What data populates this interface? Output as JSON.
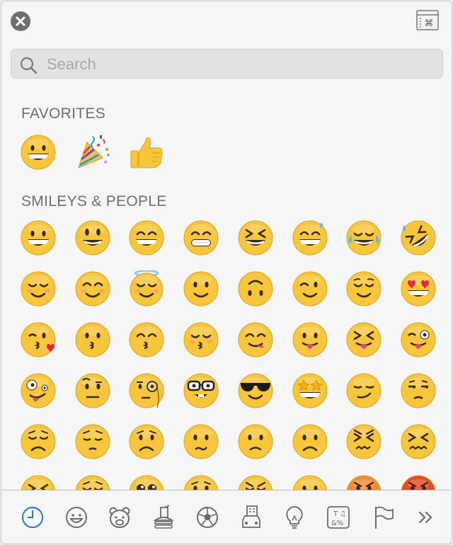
{
  "window": {
    "close_label": "Close",
    "keyboard_viewer_label": "Show Keyboard Viewer"
  },
  "search": {
    "placeholder": "Search",
    "value": ""
  },
  "sections": [
    {
      "title": "FAVORITES",
      "items": [
        "grinning",
        "party-popper",
        "thumbs-up"
      ]
    },
    {
      "title": "SMILEYS & PEOPLE",
      "items": [
        "grinning",
        "smiley",
        "smile",
        "grin",
        "laughing",
        "sweat-smile",
        "joy",
        "rofl",
        "relaxed",
        "blush",
        "innocent",
        "slight-smile",
        "upside-down",
        "wink",
        "relieved",
        "heart-eyes",
        "kissing-heart",
        "kissing",
        "kissing-smiling-eyes",
        "kissing-closed-eyes",
        "yum",
        "tongue",
        "squinting-tongue",
        "winking-tongue",
        "zany",
        "raised-eyebrow",
        "monocle",
        "nerd",
        "sunglasses",
        "star-struck",
        "smirk",
        "unamused",
        "disappointed",
        "pensive",
        "worried",
        "confused",
        "slight-frown",
        "frowning",
        "persevere",
        "confounded",
        "tired",
        "weary",
        "pleading",
        "cry",
        "triumph",
        "grimace",
        "angry",
        "rage"
      ]
    }
  ],
  "categories": [
    {
      "name": "Frequently Used",
      "icon": "clock-icon",
      "active": true
    },
    {
      "name": "Smileys & People",
      "icon": "smiley-icon",
      "active": false
    },
    {
      "name": "Animals & Nature",
      "icon": "bear-icon",
      "active": false
    },
    {
      "name": "Food & Drink",
      "icon": "food-icon",
      "active": false
    },
    {
      "name": "Activity",
      "icon": "ball-icon",
      "active": false
    },
    {
      "name": "Travel & Places",
      "icon": "car-icon",
      "active": false
    },
    {
      "name": "Objects",
      "icon": "bulb-icon",
      "active": false
    },
    {
      "name": "Symbols",
      "icon": "symbols-icon",
      "active": false
    },
    {
      "name": "Flags",
      "icon": "flag-icon",
      "active": false
    },
    {
      "name": "More",
      "icon": "chevron-double-right-icon",
      "active": false
    }
  ],
  "colors": {
    "accent": "#1a73e8",
    "emoji_face": "#f7c63b",
    "icon_gray": "#6b6b6b"
  }
}
